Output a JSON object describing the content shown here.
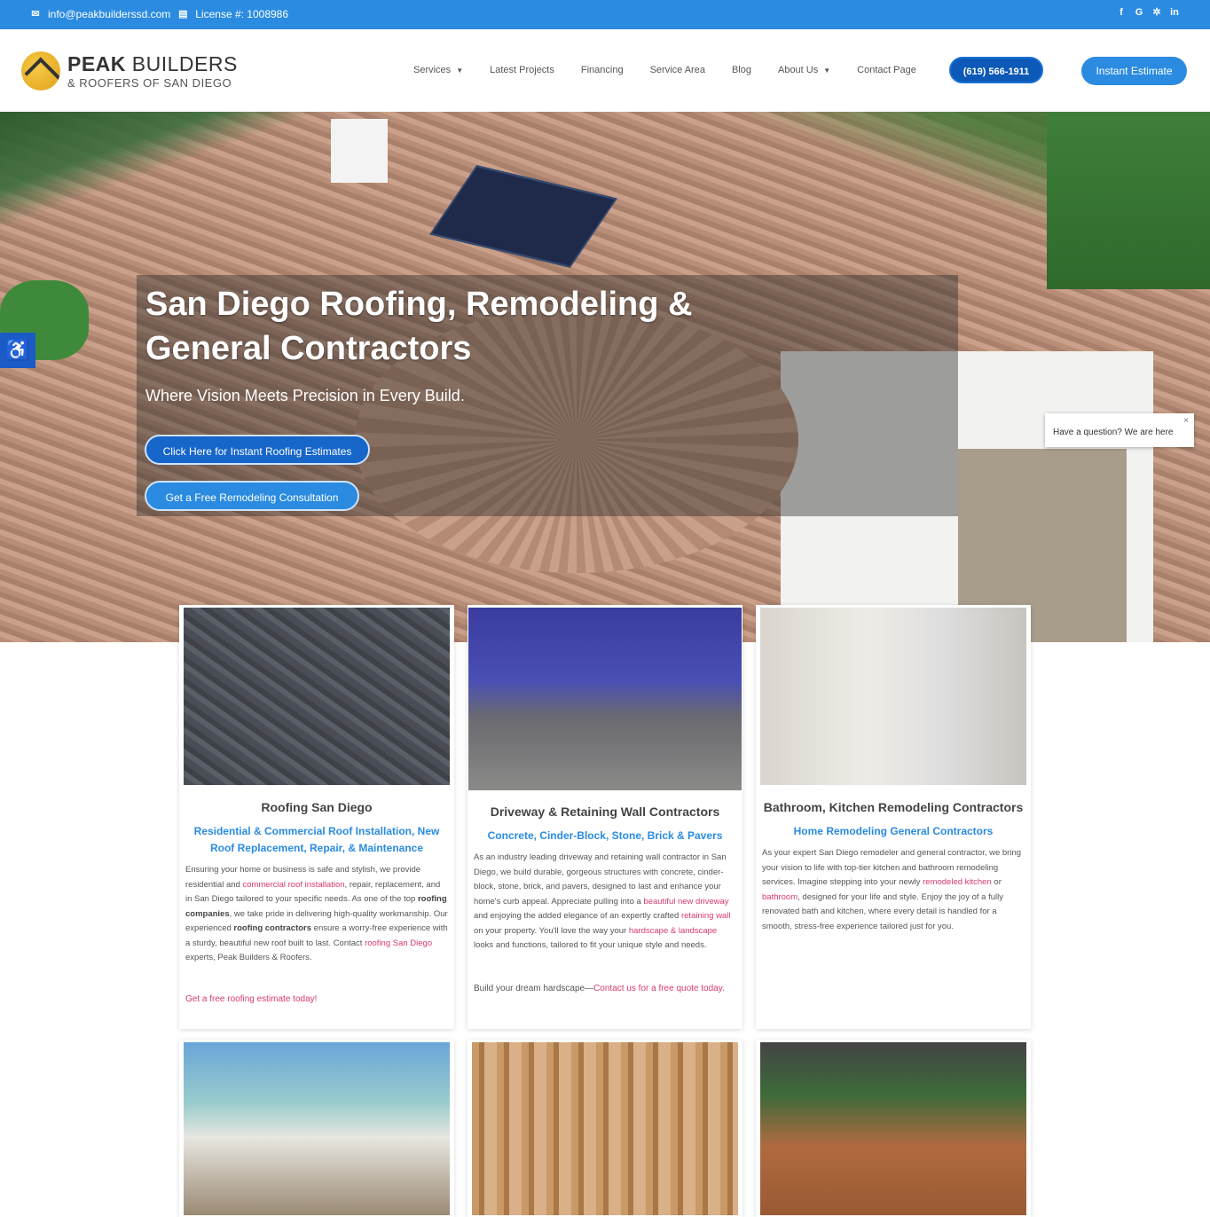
{
  "topbar": {
    "email": "info@peakbuilderssd.com",
    "license": "License #: 1008986",
    "social": [
      "facebook-icon",
      "google-icon",
      "yelp-icon",
      "linkedin-icon"
    ]
  },
  "header": {
    "logo_bold": "PEAK",
    "logo_rest": "BUILDERS",
    "logo_sub": "& ROOFERS OF SAN DIEGO",
    "nav": [
      {
        "label": "Services",
        "dropdown": true
      },
      {
        "label": "Latest Projects",
        "dropdown": false
      },
      {
        "label": "Financing",
        "dropdown": false
      },
      {
        "label": "Service Area",
        "dropdown": false
      },
      {
        "label": "Blog",
        "dropdown": false
      },
      {
        "label": "About Us",
        "dropdown": true
      },
      {
        "label": "Contact Page",
        "dropdown": false
      }
    ],
    "phone": "(619) 566-1911",
    "estimate": "Instant Estimate"
  },
  "hero": {
    "title": "San Diego Roofing, Remodeling & General Contractors",
    "subtitle": "Where Vision Meets Precision in Every Build.",
    "button1": "Click Here for Instant Roofing Estimates",
    "button2": "Get a Free Remodeling Consultation"
  },
  "chat": {
    "text": "Have a question? We are here",
    "close": "×"
  },
  "cards": [
    {
      "title": "Roofing San Diego",
      "tagline": "Residential & Commercial Roof Installation, New Roof Replacement, Repair, & Maintenance",
      "p1": "Ensuring your home or business is safe and stylish, we provide residential and ",
      "link1": "commercial roof installation",
      "p2": ", repair, replacement, and in San Diego tailored to your specific needs. As one of the top ",
      "bold1": "roofing companies",
      "p3": ", we take pride in delivering high-quality workmanship. Our experienced ",
      "bold2": "roofing contractors",
      "p4": " ensure a worry-free experience with a sturdy, beautiful new roof built to last. Contact ",
      "link2": "roofing San Diego",
      "p5": " experts, Peak Builders & Roofers.",
      "cta": "Get a free roofing estimate today!"
    },
    {
      "title": "Driveway & Retaining Wall Contractors",
      "tagline": "Concrete, Cinder-Block, Stone, Brick & Pavers",
      "p1": "As an industry leading driveway and retaining wall contractor in San Diego, we build durable, gorgeous structures with concrete, cinder-block, stone, brick, and pavers, designed to last and enhance your home's curb appeal. Appreciate pulling into a ",
      "link1": "beautiful new driveway",
      "p2": " and enjoying the added elegance of an expertly crafted ",
      "link2": "retaining wall",
      "p3": " on your property. You'll love the way your ",
      "link3": "hardscape & landscape",
      "p4": " looks and functions, tailored to fit your unique style and needs.",
      "cta_pre": "Build your dream hardscape—",
      "cta": "Contact us for a free quote today."
    },
    {
      "title": "Bathroom, Kitchen Remodeling Contractors",
      "tagline": "Home Remodeling General Contractors",
      "p1": "As your expert San Diego remodeler and general contractor, we bring your vision to life with top-tier kitchen and bathroom remodeling services. Imagine stepping into your newly ",
      "link1": "remodeled kitchen",
      "p2": " or ",
      "link2": "bathroom",
      "p3": ", designed for your life and style. Enjoy the joy of a fully renovated bath and kitchen, where every detail is handled for a smooth, stress-free experience tailored just for you."
    }
  ],
  "colors": {
    "brand_blue": "#2a8be0",
    "dark_blue": "#0c59b7",
    "link_pink": "#d83a6a"
  }
}
